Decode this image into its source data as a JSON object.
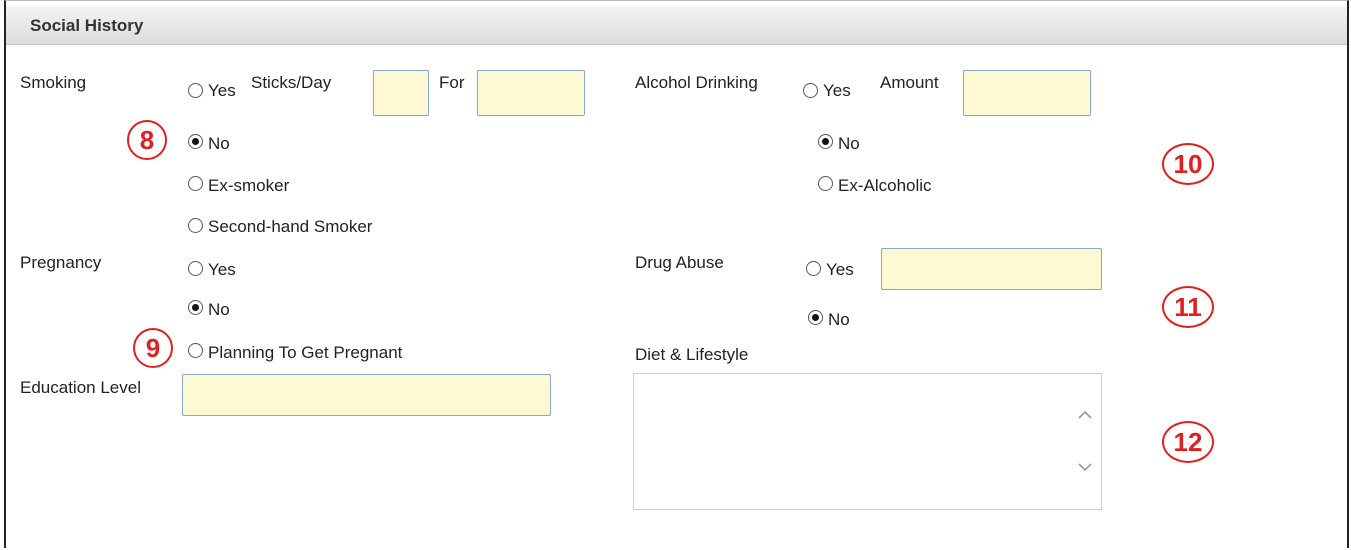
{
  "section": {
    "title": "Social History"
  },
  "smoking": {
    "label": "Smoking",
    "options": [
      "Yes",
      "No",
      "Ex-smoker",
      "Second-hand Smoker"
    ],
    "selected": "No",
    "sticks_label": "Sticks/Day",
    "for_label": "For",
    "sticks_value": "",
    "for_value": ""
  },
  "alcohol": {
    "label": "Alcohol Drinking",
    "options": [
      "Yes",
      "No",
      "Ex-Alcoholic"
    ],
    "selected": "No",
    "amount_label": "Amount",
    "amount_value": ""
  },
  "pregnancy": {
    "label": "Pregnancy",
    "options": [
      "Yes",
      "No",
      "Planning To Get Pregnant"
    ],
    "selected": "No"
  },
  "drug": {
    "label": "Drug Abuse",
    "options": [
      "Yes",
      "No"
    ],
    "selected": "No",
    "detail_value": ""
  },
  "education": {
    "label": "Education Level",
    "value": ""
  },
  "diet": {
    "label": "Diet & Lifestyle",
    "value": ""
  },
  "annotations": [
    "8",
    "9",
    "10",
    "11",
    "12"
  ],
  "colors": {
    "field_bg": "#fff9d3",
    "annotation": "#e02020",
    "header_bg": "#e6e6e6"
  }
}
